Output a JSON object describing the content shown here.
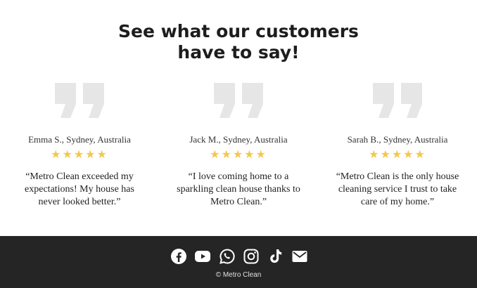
{
  "testimonials": {
    "title": "See what our customers have to say!",
    "items": [
      {
        "reviewer": "Emma S., Sydney, Australia",
        "rating": 5,
        "stars": "★★★★★",
        "quote": "“Metro Clean exceeded my expectations! My house has never looked better.”"
      },
      {
        "reviewer": "Jack M., Sydney, Australia",
        "rating": 5,
        "stars": "★★★★★",
        "quote": "“I love coming home to a sparkling clean house thanks to Metro Clean.”"
      },
      {
        "reviewer": "Sarah B., Sydney, Australia",
        "rating": 5,
        "stars": "★★★★★",
        "quote": "“Metro Clean is the only house cleaning service I trust to take care of my home.”"
      }
    ]
  },
  "footer": {
    "social_icons": [
      "facebook-icon",
      "youtube-icon",
      "whatsapp-icon",
      "instagram-icon",
      "tiktok-icon",
      "email-icon"
    ],
    "copyright": "© Metro Clean"
  },
  "colors": {
    "star": "#f2c94c",
    "quote_mark": "#e6e6e6",
    "footer_bg": "#252525",
    "footer_icon": "#ffffff"
  }
}
